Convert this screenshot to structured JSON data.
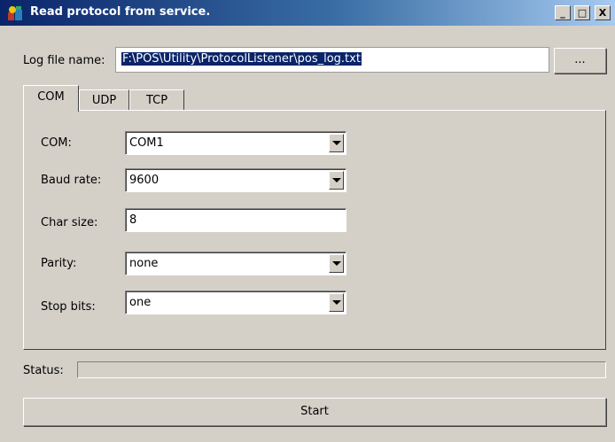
{
  "window": {
    "title": "Read protocol from service.",
    "controls": {
      "minimize": "_",
      "maximize": "□",
      "close": "X"
    }
  },
  "log_file": {
    "label": "Log file name:",
    "value": "F:\\POS\\Utility\\ProtocolListener\\pos_log.txt",
    "browse_label": "..."
  },
  "tabs": [
    {
      "label": "COM",
      "active": true
    },
    {
      "label": "UDP",
      "active": false
    },
    {
      "label": "TCP",
      "active": false
    }
  ],
  "com_settings": {
    "com": {
      "label": "COM:",
      "value": "COM1"
    },
    "baud_rate": {
      "label": "Baud rate:",
      "value": "9600"
    },
    "char_size": {
      "label": "Char size:",
      "value": "8"
    },
    "parity": {
      "label": "Parity:",
      "value": "none"
    },
    "stop_bits": {
      "label": "Stop bits:",
      "value": "one"
    }
  },
  "status": {
    "label": "Status:",
    "progress": 0
  },
  "start_button": {
    "label": "Start"
  },
  "icons": {
    "app": "app-colorful-icon",
    "dropdown": "chevron-down-icon"
  }
}
